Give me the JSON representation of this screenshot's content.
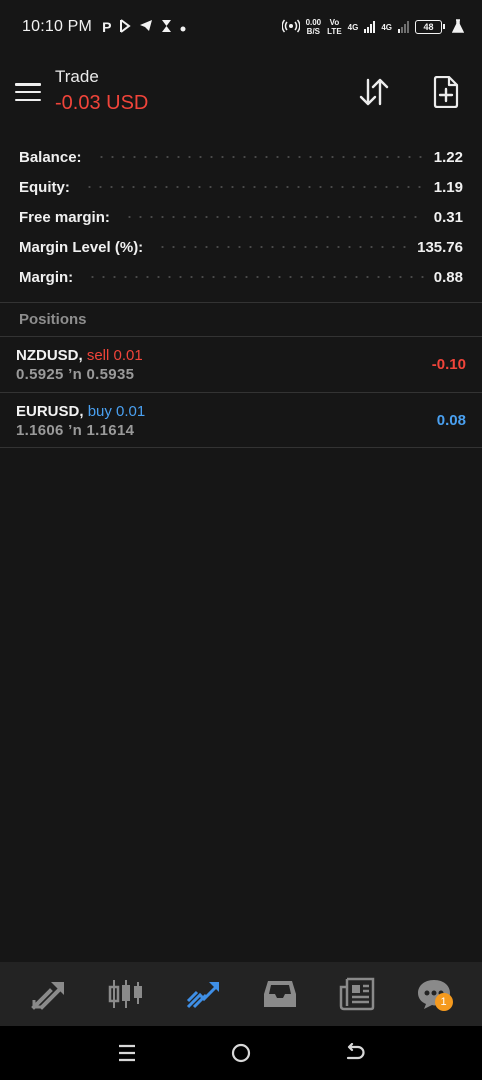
{
  "status_bar": {
    "time": "10:10 PM",
    "speed_value": "0.00",
    "speed_unit": "B/S",
    "volte_top": "Vo",
    "volte_bottom": "LTE",
    "net1": "4G",
    "net2": "4G",
    "battery": "48"
  },
  "header": {
    "title": "Trade",
    "pnl": "-0.03 USD",
    "menu_icon": "hamburger-menu-icon",
    "sort_icon": "sort-arrows-icon",
    "new_order_icon": "new-document-icon"
  },
  "summary": [
    {
      "label": "Balance:",
      "value": "1.22"
    },
    {
      "label": "Equity:",
      "value": "1.19"
    },
    {
      "label": "Free margin:",
      "value": "0.31"
    },
    {
      "label": "Margin Level (%):",
      "value": "135.76"
    },
    {
      "label": "Margin:",
      "value": "0.88"
    }
  ],
  "positions_header": "Positions",
  "positions": [
    {
      "symbol": "NZDUSD,",
      "side": "sell 0.01",
      "prices": "0.5925 ’n  0.5935",
      "profit": "-0.10"
    },
    {
      "symbol": "EURUSD,",
      "side": "buy 0.01",
      "prices": "1.1606 ’n  1.1614",
      "profit": "0.08"
    }
  ],
  "colors": {
    "background": "#161616",
    "negative": "#f0443a",
    "positive": "#4aa0f0",
    "active_tab": "#3f8fe6",
    "badge": "#f59a1e"
  },
  "tabs": [
    {
      "name": "quotes-tab",
      "icon": "quotes-arrows-icon",
      "active": false
    },
    {
      "name": "chart-tab",
      "icon": "candlestick-icon",
      "active": false
    },
    {
      "name": "trade-tab",
      "icon": "trade-trend-icon",
      "active": true
    },
    {
      "name": "history-tab",
      "icon": "inbox-tray-icon",
      "active": false
    },
    {
      "name": "news-tab",
      "icon": "newspaper-icon",
      "active": false
    },
    {
      "name": "messages-tab",
      "icon": "chat-bubble-icon",
      "active": false,
      "badge": "1"
    }
  ],
  "navbar": {
    "recent_icon": "recent-apps-icon",
    "home_icon": "home-circle-icon",
    "back_icon": "back-arrow-icon"
  }
}
